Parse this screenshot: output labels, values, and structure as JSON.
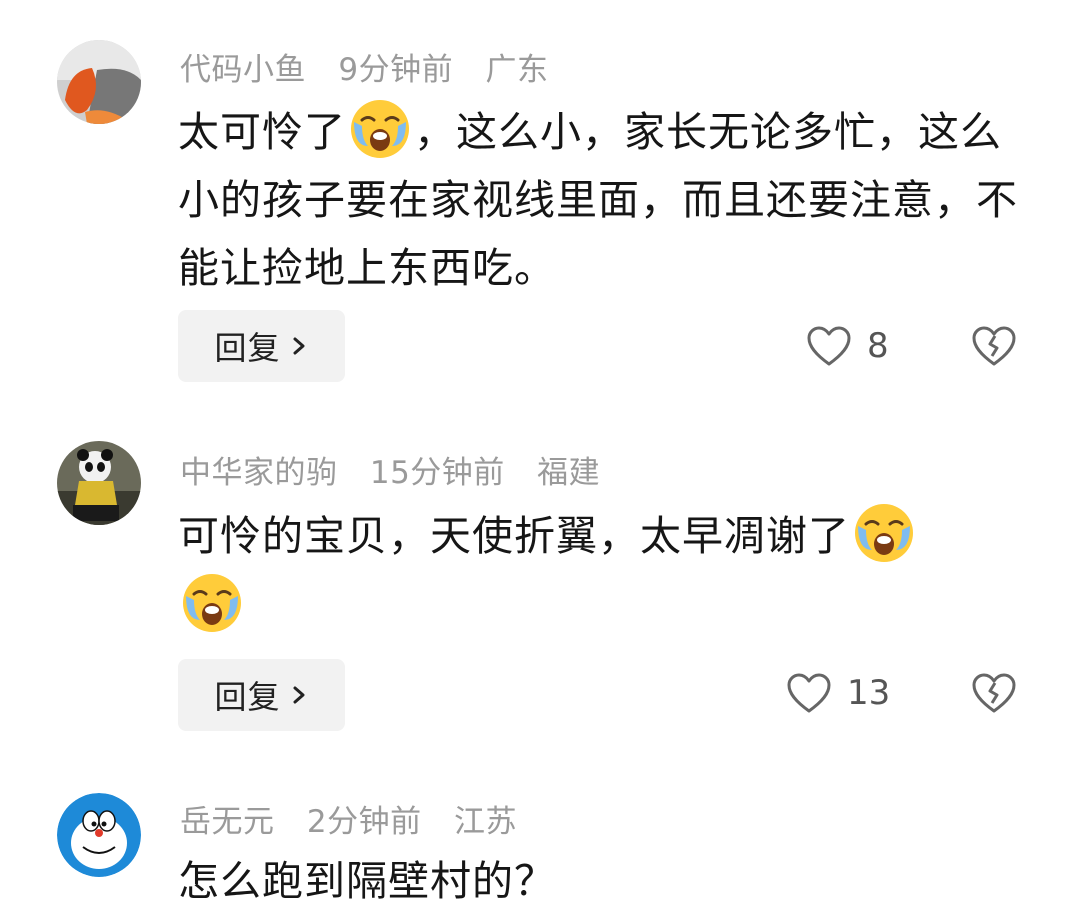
{
  "comments": [
    {
      "user": "代码小鱼",
      "time": "9分钟前",
      "location": "广东",
      "text_before_emoji": "太可怜了",
      "text_after_emoji": "，这么小，家长无论多忙，这么小的孩子要在家视线里面，而且还要注意，不能让捡地上东西吃。",
      "reply_label": "回复",
      "like_count": "8",
      "avatar_icon": "autumn-leaf-avatar"
    },
    {
      "user": "中华家的驹",
      "time": "15分钟前",
      "location": "福建",
      "text_before_emoji": "可怜的宝贝，天使折翼，太早凋谢了",
      "text_after_emoji": "",
      "reply_label": "回复",
      "like_count": "13",
      "avatar_icon": "panda-avatar"
    },
    {
      "user": "岳无元",
      "time": "2分钟前",
      "location": "江苏",
      "text": "怎么跑到隔壁村的？",
      "avatar_icon": "doraemon-avatar"
    }
  ],
  "icons": {
    "crying": "crying-face-emoji",
    "like": "heart-outline-icon",
    "dislike": "broken-heart-icon",
    "chevron": "chevron-right-icon"
  },
  "colors": {
    "meta": "#9a9a9a",
    "text": "#161616",
    "reply_bg": "#f2f2f2"
  }
}
